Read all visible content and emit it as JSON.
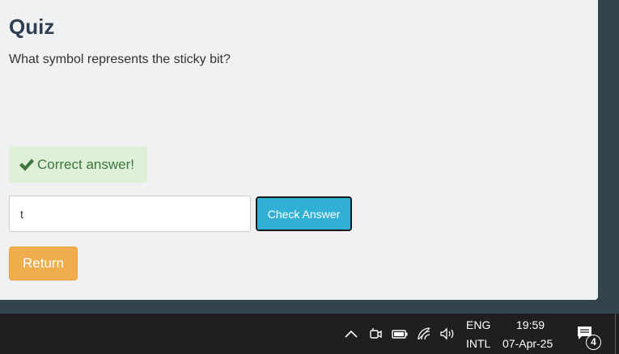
{
  "quiz": {
    "title": "Quiz",
    "question": "What symbol represents the sticky bit?",
    "feedback": "Correct answer!",
    "answer_value": "t",
    "check_label": "Check Answer",
    "return_label": "Return"
  },
  "colors": {
    "success_bg": "#dff0d8",
    "success_text": "#3c763d",
    "check_button": "#31b0d5",
    "return_button": "#f0ad4e",
    "taskbar": "#1f1f1f"
  },
  "taskbar": {
    "icons": [
      "chevron-up-icon",
      "meet-now-icon",
      "battery-icon",
      "wifi-icon",
      "speaker-icon",
      "notification-icon"
    ],
    "language_line1": "ENG",
    "language_line2": "INTL",
    "time": "19:59",
    "date": "07-Apr-25",
    "notification_count": "4"
  }
}
